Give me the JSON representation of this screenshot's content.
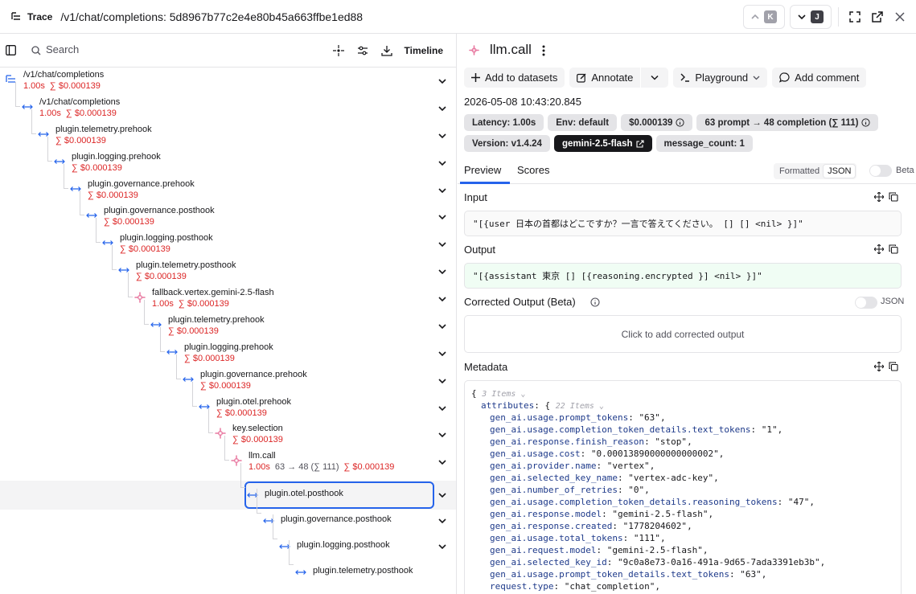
{
  "header": {
    "trace_label": "Trace",
    "title": "/v1/chat/completions: 5d8967b77c2e4e80b45a663ffbe1ed88",
    "prev_key": "K",
    "next_key": "J"
  },
  "toolbar": {
    "search_placeholder": "Search",
    "timeline_label": "Timeline"
  },
  "tree": [
    {
      "name": "/v1/chat/completions",
      "duration": "1.00s",
      "cost": "∑ $0.000139",
      "tokens": "",
      "kind": "root"
    },
    {
      "name": "/v1/chat/completions",
      "duration": "1.00s",
      "cost": "∑ $0.000139",
      "tokens": "",
      "kind": "arrow"
    },
    {
      "name": "plugin.telemetry.prehook",
      "duration": "",
      "cost": "∑ $0.000139",
      "tokens": "",
      "kind": "arrow"
    },
    {
      "name": "plugin.logging.prehook",
      "duration": "",
      "cost": "∑ $0.000139",
      "tokens": "",
      "kind": "arrow"
    },
    {
      "name": "plugin.governance.prehook",
      "duration": "",
      "cost": "∑ $0.000139",
      "tokens": "",
      "kind": "arrow"
    },
    {
      "name": "plugin.governance.posthook",
      "duration": "",
      "cost": "∑ $0.000139",
      "tokens": "",
      "kind": "arrow"
    },
    {
      "name": "plugin.logging.posthook",
      "duration": "",
      "cost": "∑ $0.000139",
      "tokens": "",
      "kind": "arrow"
    },
    {
      "name": "plugin.telemetry.posthook",
      "duration": "",
      "cost": "∑ $0.000139",
      "tokens": "",
      "kind": "arrow"
    },
    {
      "name": "fallback.vertex.gemini-2.5-flash",
      "duration": "1.00s",
      "cost": "∑ $0.000139",
      "tokens": "",
      "kind": "llm"
    },
    {
      "name": "plugin.telemetry.prehook",
      "duration": "",
      "cost": "∑ $0.000139",
      "tokens": "",
      "kind": "arrow"
    },
    {
      "name": "plugin.logging.prehook",
      "duration": "",
      "cost": "∑ $0.000139",
      "tokens": "",
      "kind": "arrow"
    },
    {
      "name": "plugin.governance.prehook",
      "duration": "",
      "cost": "∑ $0.000139",
      "tokens": "",
      "kind": "arrow"
    },
    {
      "name": "plugin.otel.prehook",
      "duration": "",
      "cost": "∑ $0.000139",
      "tokens": "",
      "kind": "arrow"
    },
    {
      "name": "key.selection",
      "duration": "",
      "cost": "∑ $0.000139",
      "tokens": "",
      "kind": "llm"
    },
    {
      "name": "llm.call",
      "duration": "1.00s",
      "cost": "∑ $0.000139",
      "tokens": "63 → 48 (∑ 111)",
      "kind": "llm"
    },
    {
      "name": "plugin.otel.posthook",
      "duration": "",
      "cost": "",
      "tokens": "",
      "kind": "arrow"
    },
    {
      "name": "plugin.governance.posthook",
      "duration": "",
      "cost": "",
      "tokens": "",
      "kind": "arrow"
    },
    {
      "name": "plugin.logging.posthook",
      "duration": "",
      "cost": "",
      "tokens": "",
      "kind": "arrow"
    },
    {
      "name": "plugin.telemetry.posthook",
      "duration": "",
      "cost": "",
      "tokens": "",
      "kind": "arrow"
    }
  ],
  "detail": {
    "title": "llm.call",
    "buttons": {
      "add_to_datasets": "Add to datasets",
      "annotate": "Annotate",
      "playground": "Playground",
      "add_comment": "Add comment"
    },
    "timestamp": "2026-05-08 10:43:20.845",
    "badges": {
      "latency": "Latency: 1.00s",
      "env": "Env: default",
      "cost": "$0.000139",
      "tokens": "63 prompt → 48 completion (∑ 111)",
      "version": "Version: v1.4.24",
      "model": "gemini-2.5-flash",
      "message_count": "message_count: 1"
    },
    "tabs": {
      "preview": "Preview",
      "scores": "Scores"
    },
    "format_toggle": {
      "formatted": "Formatted",
      "json": "JSON"
    },
    "beta_label": "Beta",
    "input_label": "Input",
    "input_value": "\"[{user 日本の首都はどこですか？一言で答えてください。 []  [] <nil> }]\"",
    "output_label": "Output",
    "output_value": "\"[{assistant 東京 []  [{reasoning.encrypted }] <nil> }]\"",
    "corrected_label": "Corrected Output (Beta)",
    "corrected_json_label": "JSON",
    "corrected_placeholder": "Click to add corrected output",
    "metadata_label": "Metadata",
    "metadata": {
      "root_count": "3 Items",
      "attributes_key": "attributes",
      "attributes_count": "22 Items",
      "rows": [
        {
          "k": "gen_ai.usage.prompt_tokens",
          "v": "\"63\""
        },
        {
          "k": "gen_ai.usage.completion_token_details.text_tokens",
          "v": "\"1\""
        },
        {
          "k": "gen_ai.response.finish_reason",
          "v": "\"stop\""
        },
        {
          "k": "gen_ai.usage.cost",
          "v": "\"0.00013890000000000002\""
        },
        {
          "k": "gen_ai.provider.name",
          "v": "\"vertex\""
        },
        {
          "k": "gen_ai.selected_key_name",
          "v": "\"vertex-adc-key\""
        },
        {
          "k": "gen_ai.number_of_retries",
          "v": "\"0\""
        },
        {
          "k": "gen_ai.usage.completion_token_details.reasoning_tokens",
          "v": "\"47\""
        },
        {
          "k": "gen_ai.response.model",
          "v": "\"gemini-2.5-flash\""
        },
        {
          "k": "gen_ai.response.created",
          "v": "\"1778204602\""
        },
        {
          "k": "gen_ai.usage.total_tokens",
          "v": "\"111\""
        },
        {
          "k": "gen_ai.request.model",
          "v": "\"gemini-2.5-flash\""
        },
        {
          "k": "gen_ai.selected_key_id",
          "v": "\"9c0a8e73-0a16-491a-9d65-7ada3391eb3b\""
        },
        {
          "k": "gen_ai.usage.prompt_token_details.text_tokens",
          "v": "\"63\""
        },
        {
          "k": "request.type",
          "v": "\"chat_completion\""
        }
      ]
    }
  },
  "colors": {
    "accent": "#2563eb",
    "cost": "#dc2626",
    "llm_icon": "#e879a0",
    "arrow_icon": "#2563eb"
  }
}
